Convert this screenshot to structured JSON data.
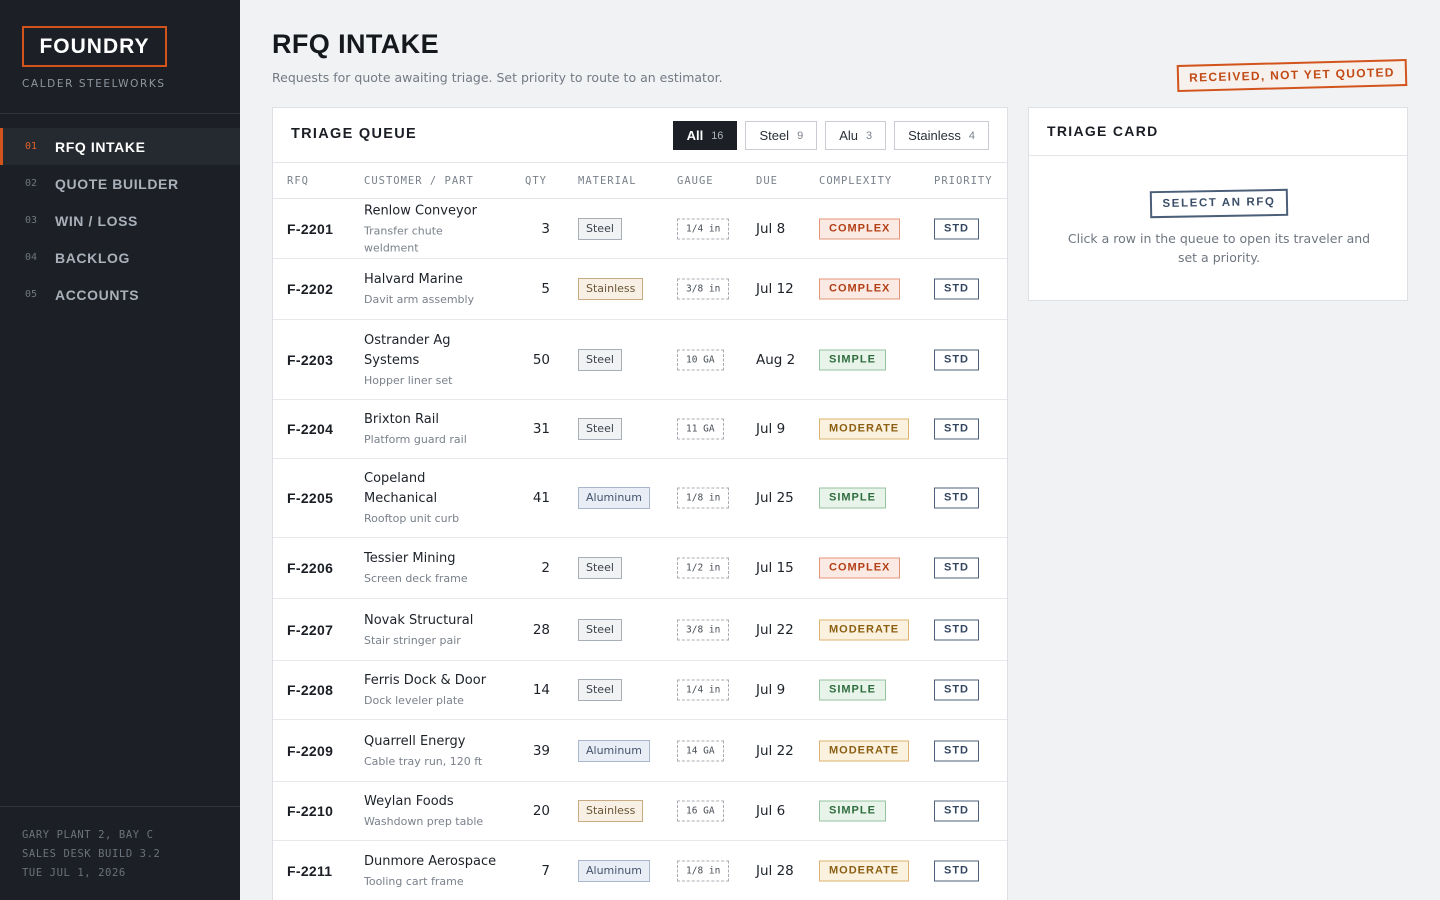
{
  "brand": {
    "name": "FOUNDRY",
    "subtitle": "CALDER STEELWORKS"
  },
  "nav": [
    {
      "num": "01",
      "label": "RFQ INTAKE",
      "active": true
    },
    {
      "num": "02",
      "label": "QUOTE BUILDER",
      "active": false
    },
    {
      "num": "03",
      "label": "WIN / LOSS",
      "active": false
    },
    {
      "num": "04",
      "label": "BACKLOG",
      "active": false
    },
    {
      "num": "05",
      "label": "ACCOUNTS",
      "active": false
    }
  ],
  "footer": {
    "line1": "GARY PLANT 2, BAY C",
    "line2": "SALES DESK BUILD 3.2",
    "line3": "TUE JUL 1, 2026"
  },
  "page": {
    "title": "RFQ INTAKE",
    "subtitle": "Requests for quote awaiting triage. Set priority to route to an estimator.",
    "stamp": "RECEIVED, NOT YET QUOTED"
  },
  "queue": {
    "title": "TRIAGE QUEUE",
    "filters": [
      {
        "label": "All",
        "count": "16",
        "active": true
      },
      {
        "label": "Steel",
        "count": "9",
        "active": false
      },
      {
        "label": "Alu",
        "count": "3",
        "active": false
      },
      {
        "label": "Stainless",
        "count": "4",
        "active": false
      }
    ],
    "columns": {
      "rfq": "RFQ",
      "customer": "CUSTOMER / PART",
      "qty": "QTY",
      "material": "MATERIAL",
      "gauge": "GAUGE",
      "due": "DUE",
      "complexity": "COMPLEXITY",
      "priority": "PRIORITY"
    },
    "rows": [
      {
        "id": "F-2201",
        "customer": "Renlow Conveyor",
        "part": "Transfer chute weldment",
        "qty": "3",
        "material": "Steel",
        "gauge": "1/4 in",
        "due": "Jul 8",
        "complexity": "COMPLEX",
        "priority": "STD"
      },
      {
        "id": "F-2202",
        "customer": "Halvard Marine",
        "part": "Davit arm assembly",
        "qty": "5",
        "material": "Stainless",
        "gauge": "3/8 in",
        "due": "Jul 12",
        "complexity": "COMPLEX",
        "priority": "STD"
      },
      {
        "id": "F-2203",
        "customer": "Ostrander Ag Systems",
        "part": "Hopper liner set",
        "qty": "50",
        "material": "Steel",
        "gauge": "10 GA",
        "due": "Aug 2",
        "complexity": "SIMPLE",
        "priority": "STD"
      },
      {
        "id": "F-2204",
        "customer": "Brixton Rail",
        "part": "Platform guard rail",
        "qty": "31",
        "material": "Steel",
        "gauge": "11 GA",
        "due": "Jul 9",
        "complexity": "MODERATE",
        "priority": "STD"
      },
      {
        "id": "F-2205",
        "customer": "Copeland Mechanical",
        "part": "Rooftop unit curb",
        "qty": "41",
        "material": "Aluminum",
        "gauge": "1/8 in",
        "due": "Jul 25",
        "complexity": "SIMPLE",
        "priority": "STD"
      },
      {
        "id": "F-2206",
        "customer": "Tessier Mining",
        "part": "Screen deck frame",
        "qty": "2",
        "material": "Steel",
        "gauge": "1/2 in",
        "due": "Jul 15",
        "complexity": "COMPLEX",
        "priority": "STD"
      },
      {
        "id": "F-2207",
        "customer": "Novak Structural",
        "part": "Stair stringer pair",
        "qty": "28",
        "material": "Steel",
        "gauge": "3/8 in",
        "due": "Jul 22",
        "complexity": "MODERATE",
        "priority": "STD"
      },
      {
        "id": "F-2208",
        "customer": "Ferris Dock & Door",
        "part": "Dock leveler plate",
        "qty": "14",
        "material": "Steel",
        "gauge": "1/4 in",
        "due": "Jul 9",
        "complexity": "SIMPLE",
        "priority": "STD"
      },
      {
        "id": "F-2209",
        "customer": "Quarrell Energy",
        "part": "Cable tray run, 120 ft",
        "qty": "39",
        "material": "Aluminum",
        "gauge": "14 GA",
        "due": "Jul 22",
        "complexity": "MODERATE",
        "priority": "STD"
      },
      {
        "id": "F-2210",
        "customer": "Weylan Foods",
        "part": "Washdown prep table",
        "qty": "20",
        "material": "Stainless",
        "gauge": "16 GA",
        "due": "Jul 6",
        "complexity": "SIMPLE",
        "priority": "STD"
      },
      {
        "id": "F-2211",
        "customer": "Dunmore Aerospace",
        "part": "Tooling cart frame",
        "qty": "7",
        "material": "Aluminum",
        "gauge": "1/8 in",
        "due": "Jul 28",
        "complexity": "MODERATE",
        "priority": "STD"
      }
    ]
  },
  "triage_card": {
    "title": "TRIAGE CARD",
    "stamp": "SELECT AN RFQ",
    "hint": "Click a row in the queue to open its traveler and set a priority."
  },
  "colors": {
    "accent": "#d2541c",
    "sidebar": "#1c2026",
    "complex": "#b23f16",
    "simple": "#2f6d3e",
    "moderate": "#8c5f12"
  }
}
